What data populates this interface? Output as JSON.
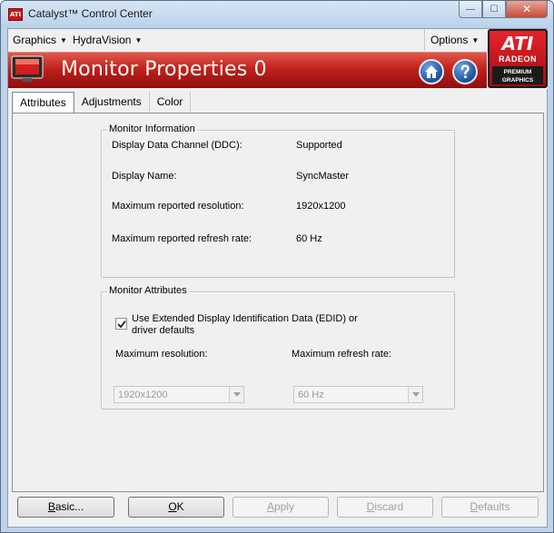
{
  "window": {
    "title": "Catalyst™ Control Center",
    "controls": {
      "minimize": "—",
      "maximize": "☐",
      "close": "✕"
    }
  },
  "menu": {
    "graphics": "Graphics",
    "hydravision": "HydraVision",
    "options": "Options"
  },
  "banner": {
    "title": "Monitor Properties 0"
  },
  "logo": {
    "brand": "ATI",
    "line1": "RADEON",
    "line2": "PREMIUM",
    "line3": "GRAPHICS"
  },
  "tabs": [
    {
      "label": "Attributes",
      "active": true
    },
    {
      "label": "Adjustments",
      "active": false
    },
    {
      "label": "Color",
      "active": false
    }
  ],
  "monitor_information": {
    "title": "Monitor Information",
    "rows": [
      {
        "label": "Display Data Channel (DDC):",
        "value": "Supported"
      },
      {
        "label": "Display Name:",
        "value": "SyncMaster"
      },
      {
        "label": "Maximum reported resolution:",
        "value": "1920x1200"
      },
      {
        "label": "Maximum reported refresh rate:",
        "value": "60 Hz"
      }
    ]
  },
  "monitor_attributes": {
    "title": "Monitor Attributes",
    "edid_checkbox": {
      "checked": true,
      "line1": "Use Extended Display Identification Data (EDID) or",
      "line2": "driver defaults"
    },
    "max_resolution": {
      "label": "Maximum resolution:",
      "value": "1920x1200"
    },
    "max_refresh": {
      "label": "Maximum refresh rate:",
      "value": "60 Hz"
    }
  },
  "buttons": {
    "basic": {
      "prefix": "",
      "mnemonic": "B",
      "rest": "asic..."
    },
    "ok": {
      "prefix": "",
      "mnemonic": "O",
      "rest": "K"
    },
    "apply": {
      "prefix": "",
      "mnemonic": "A",
      "rest": "pply"
    },
    "discard": {
      "prefix": "",
      "mnemonic": "D",
      "rest": "iscard"
    },
    "defaults": {
      "prefix": "",
      "mnemonic": "D",
      "rest": "efaults"
    }
  },
  "colors": {
    "banner_red": "#c0211c",
    "frame_blue": "#bcd3ea",
    "disabled_text": "#a0a0a0"
  },
  "icons": [
    "ati-app-icon",
    "monitor-icon",
    "home-icon",
    "help-icon",
    "checkmark-icon",
    "chevron-down-icon"
  ]
}
